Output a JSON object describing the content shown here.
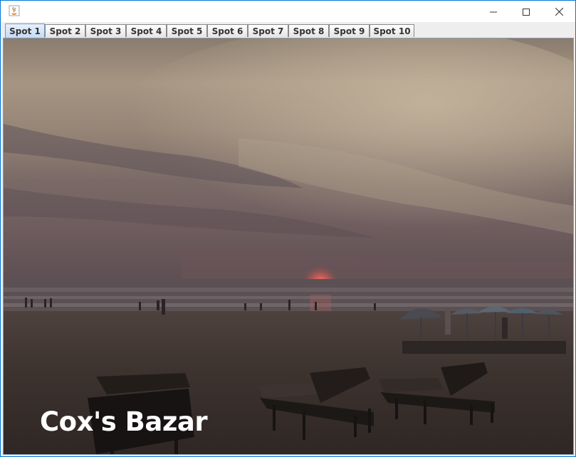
{
  "window": {
    "controls": {
      "minimize_icon": "minimize-icon",
      "maximize_icon": "maximize-icon",
      "close_icon": "close-icon"
    }
  },
  "tabs": [
    {
      "label": "Spot 1",
      "selected": true
    },
    {
      "label": "Spot 2",
      "selected": false
    },
    {
      "label": "Spot 3",
      "selected": false
    },
    {
      "label": "Spot 4",
      "selected": false
    },
    {
      "label": "Spot 5",
      "selected": false
    },
    {
      "label": "Spot 6",
      "selected": false
    },
    {
      "label": "Spot 7",
      "selected": false
    },
    {
      "label": "Spot 8",
      "selected": false
    },
    {
      "label": "Spot 9",
      "selected": false
    },
    {
      "label": "Spot 10",
      "selected": false
    }
  ],
  "main": {
    "caption": "Cox's Bazar"
  },
  "colors": {
    "window_border": "#0078d7",
    "selected_tab": "#c4daf5",
    "caption_text": "#ffffff"
  }
}
